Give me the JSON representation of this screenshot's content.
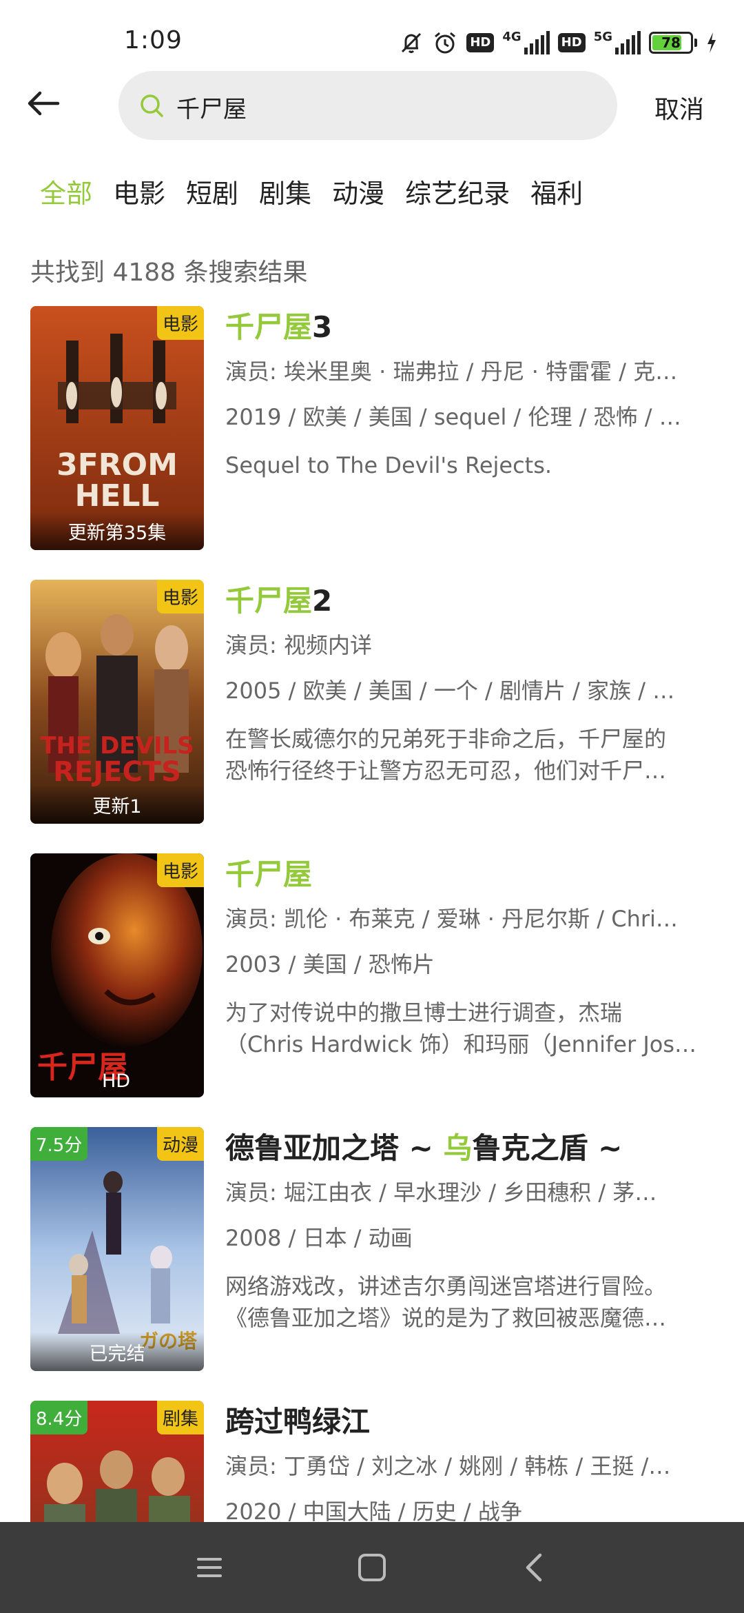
{
  "status_bar": {
    "time": "1:09",
    "hd1": "HD",
    "net1": "4G",
    "hd2": "HD",
    "net2": "5G",
    "battery": "78",
    "battery_level": 0.78,
    "icons": [
      "mute-bell-icon",
      "alarm-icon",
      "signal-icon",
      "battery-icon",
      "charging-icon"
    ]
  },
  "search": {
    "query": "千尸屋",
    "cancel_label": "取消"
  },
  "tabs": [
    {
      "label": "全部",
      "active": true
    },
    {
      "label": "电影"
    },
    {
      "label": "短剧"
    },
    {
      "label": "剧集"
    },
    {
      "label": "动漫"
    },
    {
      "label": "综艺纪录"
    },
    {
      "label": "福利"
    }
  ],
  "result_count_text": "共找到 4188 条搜索结果",
  "colors": {
    "accent": "#93c93a",
    "type_badge": "#f2c416",
    "score_badge": "#3fae3b",
    "nav_bar": "#3c3c3c"
  },
  "results": [
    {
      "type": "电影",
      "update": "更新第35集",
      "title_hl": "千尸屋",
      "title_rest": "3",
      "actors": "演员: 埃米里奥 · 瑞弗拉 / 丹尼 · 特雷霍 / 克…",
      "meta": "2019 / 欧美 / 美国 / sequel / 伦理 / 恐怖 / …",
      "desc1": "Sequel to The Devil's Rejects.",
      "desc2": ""
    },
    {
      "type": "电影",
      "update": "更新1",
      "title_hl": "千尸屋",
      "title_rest": "2",
      "actors": "演员: 视频内详",
      "meta": "2005 / 欧美 / 美国 / 一个 / 剧情片 / 家族 / …",
      "desc1": "在警长威德尔的兄弟死于非命之后，千尸屋的",
      "desc2": "恐怖行径终于让警方忍无可忍，他们对千尸…"
    },
    {
      "type": "电影",
      "update": "HD",
      "title_hl": "千尸屋",
      "title_rest": "",
      "actors": "演员: 凯伦 · 布莱克 / 爱琳 · 丹尼尔斯 / Chri…",
      "meta": "2003 / 美国 / 恐怖片",
      "desc1": "为了对传说中的撒旦博士进行调查，杰瑞",
      "desc2": "（Chris Hardwick 饰）和玛丽（Jennifer Jos…"
    },
    {
      "type": "动漫",
      "score": "7.5分",
      "update": "已完结",
      "title_pre": "德鲁亚加之塔 ~ ",
      "title_hl": "乌",
      "title_rest": "鲁克之盾 ~",
      "actors": "演员: 堀江由衣 / 早水理沙 / 乡田穗积 / 茅…",
      "meta": "2008 / 日本 / 动画",
      "desc1": "网络游戏改，讲述吉尔勇闯迷宫塔进行冒险。",
      "desc2": "《德鲁亚加之塔》说的是为了救回被恶魔德…"
    },
    {
      "type": "剧集",
      "score": "8.4分",
      "title_pre": "跨过鸭绿江",
      "actors": "演员: 丁勇岱 / 刘之冰 / 姚刚 / 韩栋 / 王挺 /…",
      "meta": "2020 / 中国大陆 / 历史 / 战争"
    }
  ],
  "nav": {
    "icons": [
      "menu-icon",
      "home-square-icon",
      "back-chevron-icon"
    ]
  }
}
